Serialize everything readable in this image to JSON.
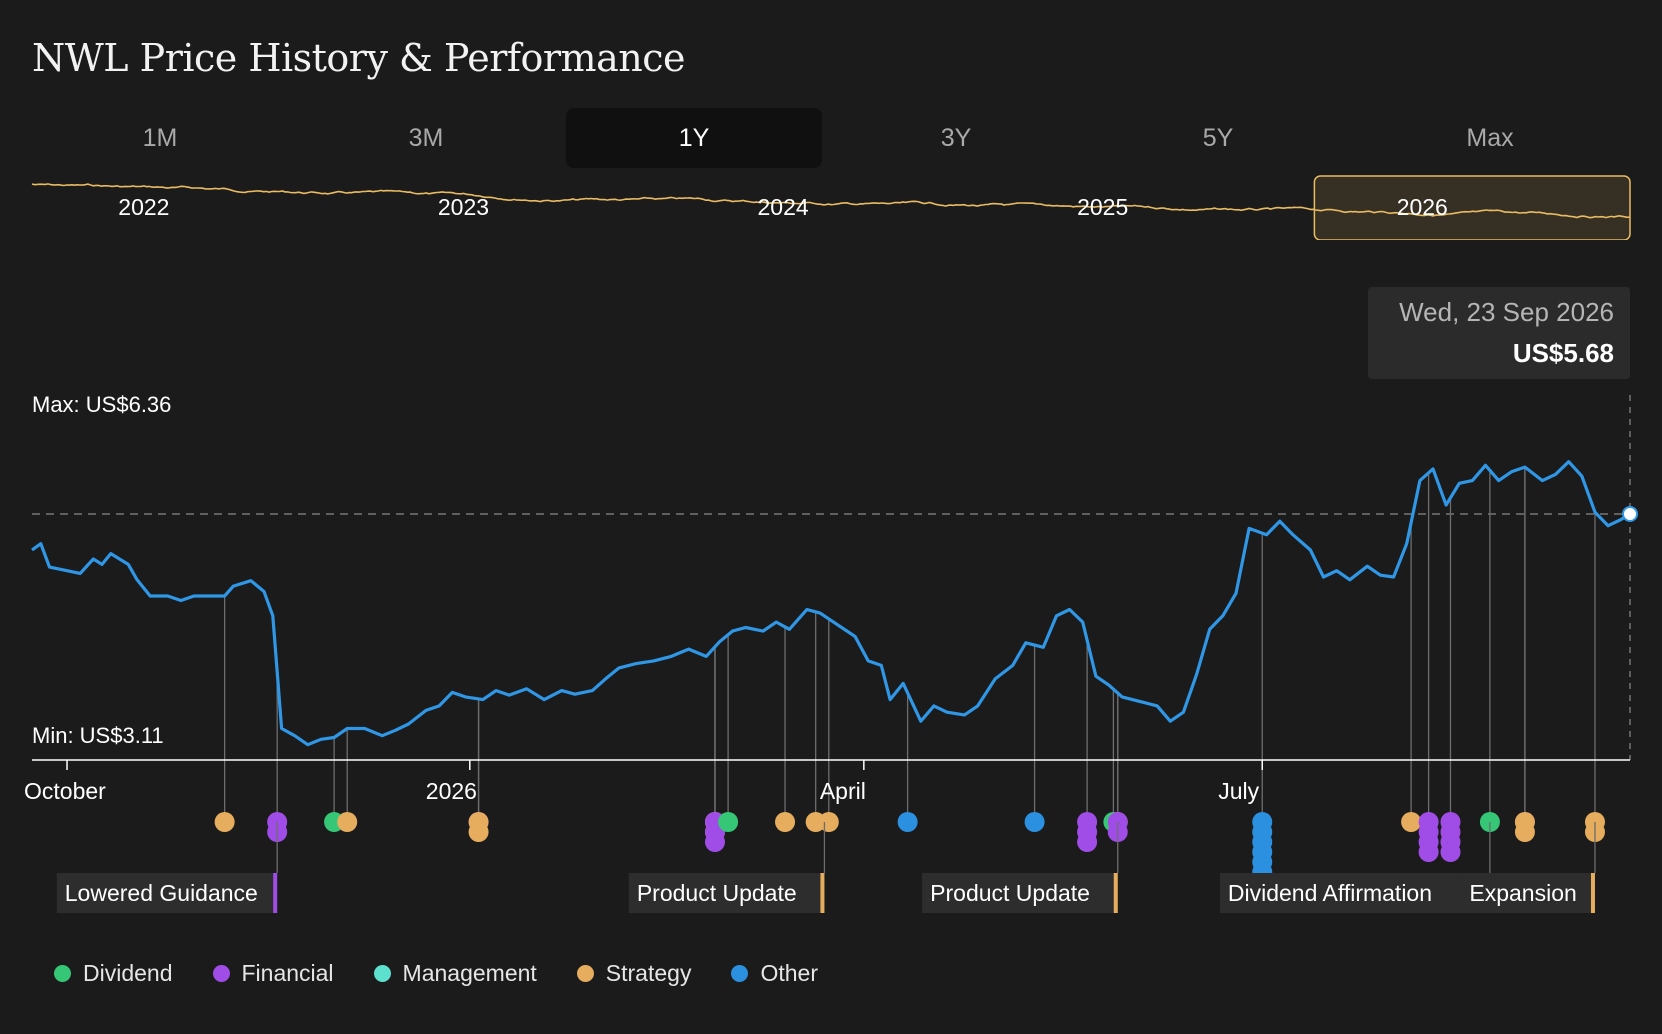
{
  "page": {
    "title": "NWL Price History & Performance"
  },
  "range_tabs": [
    {
      "label": "1M",
      "active": false
    },
    {
      "label": "3M",
      "active": false
    },
    {
      "label": "1Y",
      "active": true
    },
    {
      "label": "3Y",
      "active": false
    },
    {
      "label": "5Y",
      "active": false
    },
    {
      "label": "Max",
      "active": false
    }
  ],
  "colors": {
    "background": "#1b1b1b",
    "price_line": "#2f97e6",
    "overview_line": "#e9bb63",
    "Dividend": "#35c776",
    "Financial": "#a04de8",
    "Management": "#5ee0cf",
    "Strategy": "#e6ad5e",
    "Other": "#2b90e0"
  },
  "overview": {
    "year_labels": [
      "2022",
      "2023",
      "2024",
      "2025",
      "2026"
    ],
    "selected_year": "2026"
  },
  "tooltip": {
    "date": "Wed, 23 Sep 2026",
    "price": "US$5.68"
  },
  "chart_data": {
    "type": "line",
    "x_start": "2025-09-23",
    "x_end": "2026-09-23",
    "ylim": [
      2.95,
      7.0
    ],
    "max_label": "Max: US$6.36",
    "min_label": "Min: US$3.11",
    "reference_line_value": 5.68,
    "grid": false,
    "x_ticks": [
      {
        "date": "2025-10-01",
        "label": "October"
      },
      {
        "date": "2026-01-01",
        "label": "2026"
      },
      {
        "date": "2026-04-01",
        "label": "April"
      },
      {
        "date": "2026-07-01",
        "label": "July"
      }
    ],
    "series": [
      {
        "points": [
          [
            "2025-09-23",
            5.28
          ],
          [
            "2025-09-25",
            5.35
          ],
          [
            "2025-09-27",
            5.09
          ],
          [
            "2025-10-01",
            5.05
          ],
          [
            "2025-10-04",
            5.02
          ],
          [
            "2025-10-07",
            5.18
          ],
          [
            "2025-10-09",
            5.12
          ],
          [
            "2025-10-11",
            5.24
          ],
          [
            "2025-10-15",
            5.12
          ],
          [
            "2025-10-17",
            4.95
          ],
          [
            "2025-10-20",
            4.77
          ],
          [
            "2025-10-24",
            4.77
          ],
          [
            "2025-10-27",
            4.72
          ],
          [
            "2025-10-30",
            4.77
          ],
          [
            "2025-11-03",
            4.77
          ],
          [
            "2025-11-06",
            4.77
          ],
          [
            "2025-11-08",
            4.88
          ],
          [
            "2025-11-12",
            4.94
          ],
          [
            "2025-11-15",
            4.82
          ],
          [
            "2025-11-17",
            4.55
          ],
          [
            "2025-11-19",
            3.3
          ],
          [
            "2025-11-22",
            3.22
          ],
          [
            "2025-11-25",
            3.12
          ],
          [
            "2025-11-28",
            3.18
          ],
          [
            "2025-12-01",
            3.2
          ],
          [
            "2025-12-04",
            3.3
          ],
          [
            "2025-12-08",
            3.3
          ],
          [
            "2025-12-12",
            3.22
          ],
          [
            "2025-12-15",
            3.28
          ],
          [
            "2025-12-18",
            3.35
          ],
          [
            "2025-12-22",
            3.5
          ],
          [
            "2025-12-25",
            3.55
          ],
          [
            "2025-12-28",
            3.7
          ],
          [
            "2025-12-31",
            3.65
          ],
          [
            "2026-01-04",
            3.62
          ],
          [
            "2026-01-07",
            3.72
          ],
          [
            "2026-01-10",
            3.67
          ],
          [
            "2026-01-14",
            3.74
          ],
          [
            "2026-01-18",
            3.62
          ],
          [
            "2026-01-22",
            3.72
          ],
          [
            "2026-01-25",
            3.68
          ],
          [
            "2026-01-29",
            3.72
          ],
          [
            "2026-02-01",
            3.85
          ],
          [
            "2026-02-04",
            3.97
          ],
          [
            "2026-02-08",
            4.02
          ],
          [
            "2026-02-12",
            4.05
          ],
          [
            "2026-02-16",
            4.1
          ],
          [
            "2026-02-20",
            4.18
          ],
          [
            "2026-02-24",
            4.1
          ],
          [
            "2026-02-27",
            4.26
          ],
          [
            "2026-03-02",
            4.38
          ],
          [
            "2026-03-05",
            4.42
          ],
          [
            "2026-03-09",
            4.38
          ],
          [
            "2026-03-12",
            4.48
          ],
          [
            "2026-03-15",
            4.4
          ],
          [
            "2026-03-19",
            4.62
          ],
          [
            "2026-03-22",
            4.58
          ],
          [
            "2026-03-26",
            4.45
          ],
          [
            "2026-03-30",
            4.32
          ],
          [
            "2026-04-02",
            4.05
          ],
          [
            "2026-04-05",
            4.0
          ],
          [
            "2026-04-07",
            3.62
          ],
          [
            "2026-04-10",
            3.8
          ],
          [
            "2026-04-14",
            3.38
          ],
          [
            "2026-04-17",
            3.55
          ],
          [
            "2026-04-20",
            3.48
          ],
          [
            "2026-04-24",
            3.45
          ],
          [
            "2026-04-27",
            3.55
          ],
          [
            "2026-05-01",
            3.85
          ],
          [
            "2026-05-05",
            4.0
          ],
          [
            "2026-05-08",
            4.25
          ],
          [
            "2026-05-12",
            4.2
          ],
          [
            "2026-05-15",
            4.55
          ],
          [
            "2026-05-18",
            4.62
          ],
          [
            "2026-05-21",
            4.48
          ],
          [
            "2026-05-24",
            3.88
          ],
          [
            "2026-05-27",
            3.78
          ],
          [
            "2026-05-30",
            3.65
          ],
          [
            "2026-06-03",
            3.6
          ],
          [
            "2026-06-07",
            3.55
          ],
          [
            "2026-06-10",
            3.38
          ],
          [
            "2026-06-13",
            3.48
          ],
          [
            "2026-06-16",
            3.9
          ],
          [
            "2026-06-19",
            4.4
          ],
          [
            "2026-06-22",
            4.55
          ],
          [
            "2026-06-25",
            4.8
          ],
          [
            "2026-06-28",
            5.52
          ],
          [
            "2026-07-02",
            5.45
          ],
          [
            "2026-07-05",
            5.6
          ],
          [
            "2026-07-08",
            5.45
          ],
          [
            "2026-07-12",
            5.28
          ],
          [
            "2026-07-15",
            4.98
          ],
          [
            "2026-07-18",
            5.05
          ],
          [
            "2026-07-21",
            4.95
          ],
          [
            "2026-07-25",
            5.1
          ],
          [
            "2026-07-28",
            5.0
          ],
          [
            "2026-07-31",
            4.98
          ],
          [
            "2026-08-03",
            5.35
          ],
          [
            "2026-08-06",
            6.05
          ],
          [
            "2026-08-09",
            6.18
          ],
          [
            "2026-08-12",
            5.78
          ],
          [
            "2026-08-15",
            6.02
          ],
          [
            "2026-08-18",
            6.05
          ],
          [
            "2026-08-21",
            6.22
          ],
          [
            "2026-08-24",
            6.05
          ],
          [
            "2026-08-27",
            6.15
          ],
          [
            "2026-08-30",
            6.2
          ],
          [
            "2026-09-03",
            6.05
          ],
          [
            "2026-09-06",
            6.12
          ],
          [
            "2026-09-09",
            6.26
          ],
          [
            "2026-09-12",
            6.1
          ],
          [
            "2026-09-15",
            5.7
          ],
          [
            "2026-09-18",
            5.55
          ],
          [
            "2026-09-21",
            5.62
          ],
          [
            "2026-09-23",
            5.68
          ]
        ]
      }
    ],
    "event_markers": [
      {
        "date": "2025-11-06",
        "category": "Strategy",
        "stack": 1
      },
      {
        "date": "2025-11-18",
        "category": "Financial",
        "stack": 2
      },
      {
        "date": "2025-12-01",
        "category": "Dividend",
        "stack": 1
      },
      {
        "date": "2025-12-04",
        "category": "Strategy",
        "stack": 1
      },
      {
        "date": "2026-01-03",
        "category": "Financial",
        "stack": 1
      },
      {
        "date": "2026-01-03",
        "category": "Strategy",
        "stack": 2
      },
      {
        "date": "2026-02-26",
        "category": "Financial",
        "stack": 1
      },
      {
        "date": "2026-02-26",
        "category": "Strategy",
        "stack": 2
      },
      {
        "date": "2026-02-26",
        "category": "Financial",
        "stack": 3
      },
      {
        "date": "2026-03-01",
        "category": "Dividend",
        "stack": 1
      },
      {
        "date": "2026-03-14",
        "category": "Strategy",
        "stack": 1
      },
      {
        "date": "2026-03-21",
        "category": "Strategy",
        "stack": 1
      },
      {
        "date": "2026-03-24",
        "category": "Strategy",
        "stack": 1
      },
      {
        "date": "2026-04-11",
        "category": "Other",
        "stack": 1
      },
      {
        "date": "2026-05-10",
        "category": "Other",
        "stack": 1
      },
      {
        "date": "2026-05-22",
        "category": "Financial",
        "stack": 3
      },
      {
        "date": "2026-05-28",
        "category": "Dividend",
        "stack": 1
      },
      {
        "date": "2026-05-29",
        "category": "Strategy",
        "stack": 1
      },
      {
        "date": "2026-05-29",
        "category": "Financial",
        "stack": 2
      },
      {
        "date": "2026-07-01",
        "category": "Other",
        "stack": 6
      },
      {
        "date": "2026-08-04",
        "category": "Strategy",
        "stack": 1
      },
      {
        "date": "2026-08-08",
        "category": "Financial",
        "stack": 4
      },
      {
        "date": "2026-08-13",
        "category": "Financial",
        "stack": 4
      },
      {
        "date": "2026-08-22",
        "category": "Dividend",
        "stack": 1
      },
      {
        "date": "2026-08-30",
        "category": "Financial",
        "stack": 1
      },
      {
        "date": "2026-08-30",
        "category": "Strategy",
        "stack": 2
      },
      {
        "date": "2026-09-15",
        "category": "Strategy",
        "stack": 2
      }
    ],
    "event_labels": [
      {
        "text": "Lowered Guidance",
        "category": "Financial",
        "marker_date": "2025-11-18"
      },
      {
        "text": "Product Update",
        "category": "Strategy",
        "marker_date": "2026-03-23"
      },
      {
        "text": "Product Update",
        "category": "Strategy",
        "marker_date": "2026-05-29"
      },
      {
        "text": "Dividend Affirmation",
        "category": "Dividend",
        "marker_date": "2026-08-22"
      },
      {
        "text": "Expansion",
        "category": "Strategy",
        "marker_date": "2026-09-15"
      }
    ]
  },
  "legend": [
    {
      "label": "Dividend",
      "category": "Dividend"
    },
    {
      "label": "Financial",
      "category": "Financial"
    },
    {
      "label": "Management",
      "category": "Management"
    },
    {
      "label": "Strategy",
      "category": "Strategy"
    },
    {
      "label": "Other",
      "category": "Other"
    }
  ]
}
